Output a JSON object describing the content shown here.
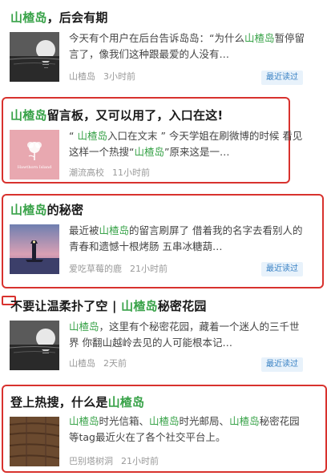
{
  "articles": [
    {
      "title_parts": [
        "山楂岛",
        "，后会有期"
      ],
      "snippet_parts": [
        "今天有个用户在后台告诉岛岛：“为什么",
        "山楂岛",
        "暂停留言了，像我们这种跟最爱的人没有…"
      ],
      "source": "山楂岛",
      "time": "3小时前",
      "badge": "最近读过",
      "thumb_icon": "moon-over-sea-icon"
    },
    {
      "title_parts": [
        "山楂岛",
        "留言板，又可以用了，入口在这!"
      ],
      "snippet_parts": [
        "“ ",
        "山楂岛",
        "入口在文末 ” 今天学姐在刷微博的时候 看见这样一个热搜“",
        "山楂岛",
        "”原来这是一…"
      ],
      "source": "潮流高校",
      "time": "11小时前",
      "thumb_icon": "flower-logo-icon",
      "thumb_text": "Hawthorn Island"
    },
    {
      "title_parts": [
        "山楂岛",
        "的秘密"
      ],
      "snippet_parts": [
        "最近被",
        "山楂岛",
        "的留言刷屏了 借着我的名字去看别人的青春和遗憾十根烤肠 五串冰糖葫…"
      ],
      "source": "爱吃草莓的鹿",
      "time": "21小时前",
      "badge": "最近读过",
      "thumb_icon": "lighthouse-icon"
    },
    {
      "title_parts": [
        "不要让温柔扑了空 | ",
        "山楂岛",
        "秘密花园"
      ],
      "snippet_parts": [
        "山楂岛",
        "，这里有个秘密花园，藏着一个迷人的三千世界 你翻山越岭去见的人可能根本记…"
      ],
      "source": "山楂岛",
      "time": "2天前",
      "badge": "最近读过",
      "thumb_icon": "moon-over-sea-icon"
    },
    {
      "title_parts": [
        "登上热搜，什么是",
        "山楂岛"
      ],
      "snippet_parts": [
        "山楂岛",
        "时光信箱、",
        "山楂岛",
        "时光邮局、",
        "山楂岛",
        "秘密花园等tag最近火在了各个社交平台上。"
      ],
      "source": "巴别塔树洞",
      "time": "21小时前",
      "thumb_icon": "wood-texture-icon"
    }
  ],
  "colors": {
    "highlight": "#3aa34a",
    "frame": "#d8322e",
    "badge_text": "#3a82c4"
  }
}
